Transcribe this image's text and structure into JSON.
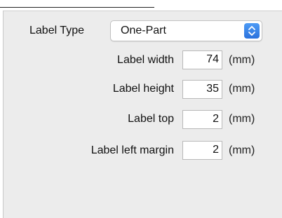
{
  "label_type": {
    "label": "Label Type",
    "selected": "One-Part"
  },
  "fields": [
    {
      "label": "Label width",
      "value": "74",
      "unit": "(mm)"
    },
    {
      "label": "Label height",
      "value": "35",
      "unit": "(mm)"
    },
    {
      "label": "Label top",
      "value": "2",
      "unit": "(mm)"
    },
    {
      "label": "Label left margin",
      "value": "2",
      "unit": "(mm)"
    }
  ],
  "colors": {
    "panel_background": "#ececec",
    "stepper_accent": "#2f7ae5"
  },
  "icons": {
    "select_arrows": "chevron-up-down-icon"
  }
}
